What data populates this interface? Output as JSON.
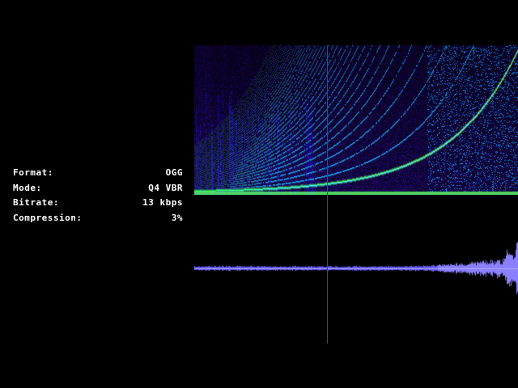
{
  "info": [
    {
      "key": "format",
      "label": "Format:",
      "value": "OGG"
    },
    {
      "key": "mode",
      "label": "Mode:",
      "value": "Q4 VBR"
    },
    {
      "key": "bitrate",
      "label": "Bitrate:",
      "value": "13 kbps"
    },
    {
      "key": "compression",
      "label": "Compression:",
      "value": "3%"
    }
  ],
  "colors": {
    "background": "#000000",
    "text": "#ffffff",
    "playhead": "#cc1111",
    "spectrogram_low": "#1a0a3a",
    "spectrogram_mid": "#2a4cff",
    "spectrogram_high": "#3ad8ff",
    "spectrogram_peak": "#7cff2a",
    "waveform": "#7a6cff"
  },
  "playback_position": 0.41
}
